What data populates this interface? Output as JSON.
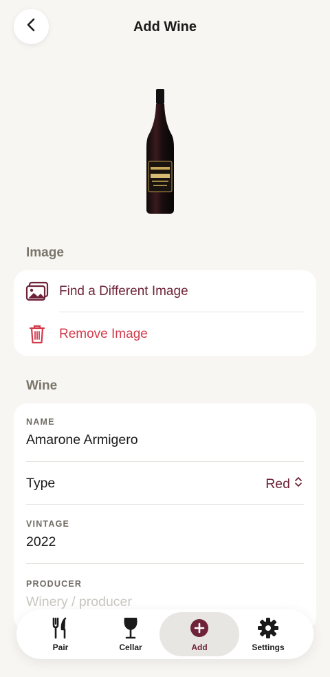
{
  "header": {
    "title": "Add Wine",
    "back_icon": "chevron-left-icon"
  },
  "bottle": {
    "label_line1": "ARMIGERO",
    "label_line2": "AMARONE",
    "label_line3": "DELLA VALPOLICELLA"
  },
  "image_section": {
    "title": "Image",
    "find_label": "Find a Different Image",
    "remove_label": "Remove Image"
  },
  "wine_section": {
    "title": "Wine",
    "name_caption": "NAME",
    "name_value": "Amarone Armigero",
    "type_label": "Type",
    "type_value": "Red",
    "vintage_caption": "VINTAGE",
    "vintage_value": "2022",
    "producer_caption": "PRODUCER",
    "producer_placeholder": "Winery / producer"
  },
  "tabbar": {
    "tabs": [
      {
        "label": "Pair",
        "icon": "fork-knife-icon"
      },
      {
        "label": "Cellar",
        "icon": "wine-glass-icon"
      },
      {
        "label": "Add",
        "icon": "plus-circle-icon"
      },
      {
        "label": "Settings",
        "icon": "gear-icon"
      }
    ],
    "active": "Add"
  },
  "colors": {
    "accent": "#6e2339",
    "destructive": "#d23a4a",
    "background": "#f8f6f2"
  }
}
